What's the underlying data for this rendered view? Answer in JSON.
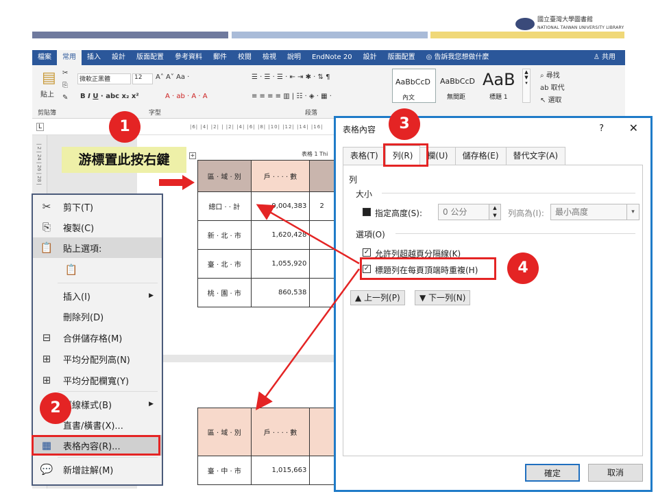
{
  "header": {
    "logo_zh": "國立臺灣大學圖書館",
    "logo_en": "NATIONAL TAIWAN UNIVERSITY LIBRARY",
    "bar_colors": [
      "#6f7a9e",
      "#a9bbd8",
      "#f0d878"
    ]
  },
  "ribbon": {
    "tabs": [
      "檔案",
      "常用",
      "插入",
      "設計",
      "版面配置",
      "參考資料",
      "郵件",
      "校閱",
      "檢視",
      "說明",
      "EndNote 20",
      "設計",
      "版面配置"
    ],
    "active_tab": "常用",
    "tell_me": "告訴我您想做什麼",
    "share": "共用",
    "font_name": "微軟正黑體",
    "font_size": "12",
    "paste_label": "貼上",
    "clipboard_group": "剪貼簿",
    "font_group": "字型",
    "paragraph_group": "段落",
    "styles": [
      {
        "preview": "AaBbCcD",
        "name": "內文"
      },
      {
        "preview": "AaBbCcD",
        "name": "無間距"
      },
      {
        "preview": "AaB",
        "name": "標題 1"
      }
    ],
    "editing": {
      "find": "尋找",
      "replace": "取代",
      "select": "選取"
    },
    "ruler_text": "|6| |4| |2| | |2| |4| |6| |8| |10| |12| |14| |16|"
  },
  "vertical_ruler": "| 2 | 24 | 26 | 28 |",
  "annotation": {
    "label": "游標置此按右鍵",
    "badges": [
      "1",
      "2",
      "3",
      "4"
    ]
  },
  "document": {
    "caption": "表格 1 Thi",
    "headers": [
      "區 · 域 · 別",
      "戶 · · · · 數"
    ],
    "rows": [
      {
        "area": "總口 · · 計",
        "households": "9,004,383",
        "extra": "2"
      },
      {
        "area": "新 · 北 · 市",
        "households": "1,620,428",
        "extra": ""
      },
      {
        "area": "臺 · 北 · 市",
        "households": "1,055,920",
        "extra": ""
      },
      {
        "area": "桃 · 園 · 市",
        "households": "860,538",
        "extra": ""
      }
    ],
    "page2_row": {
      "area": "臺 · 中 · 市",
      "households": "1,015,663"
    }
  },
  "context_menu": {
    "items": [
      {
        "icon": "✂",
        "label": "剪下(T)"
      },
      {
        "icon": "⎘",
        "label": "複製(C)"
      },
      {
        "icon": "📋",
        "label": "貼上選項:"
      },
      {
        "icon": "📋",
        "label": ""
      },
      {
        "icon": "",
        "label": "插入(I)"
      },
      {
        "icon": "",
        "label": "刪除列(D)"
      },
      {
        "icon": "⊟",
        "label": "合併儲存格(M)"
      },
      {
        "icon": "⊞",
        "label": "平均分配列高(N)"
      },
      {
        "icon": "⊞",
        "label": "平均分配欄寬(Y)"
      },
      {
        "icon": "",
        "label": "框線樣式(B)"
      },
      {
        "icon": "",
        "label": "直書/橫書(X)..."
      },
      {
        "icon": "▦",
        "label": "表格內容(R)..."
      },
      {
        "icon": "💬",
        "label": "新增註解(M)"
      }
    ]
  },
  "dialog": {
    "title": "表格內容",
    "help": "?",
    "close": "✕",
    "tabs": [
      "表格(T)",
      "列(R)",
      "欄(U)",
      "儲存格(E)",
      "替代文字(A)"
    ],
    "active_tab": "列(R)",
    "section_row": "列",
    "size_label": "大小",
    "specify_height": "指定高度(S):",
    "height_value": "0 公分",
    "row_height_is": "列高為(I):",
    "row_height_mode": "最小高度",
    "options_label": "選項(O)",
    "allow_break": "允許列超越頁分隔線(K)",
    "repeat_header": "標題列在每頁頂端時重複(H)",
    "prev_row": "上一列(P)",
    "next_row": "下一列(N)",
    "ok": "確定",
    "cancel": "取消"
  }
}
